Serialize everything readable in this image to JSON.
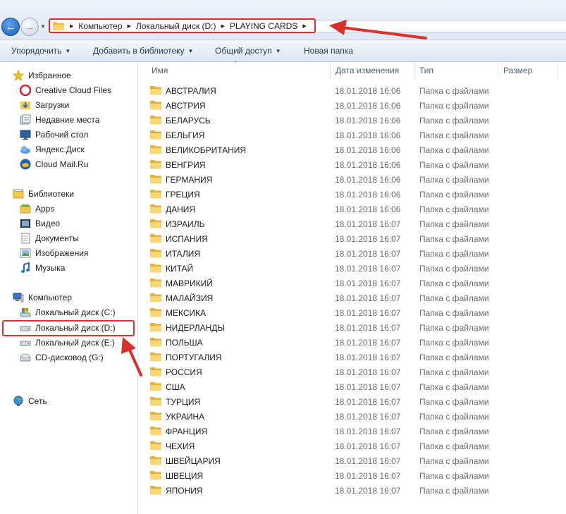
{
  "address_bar": {
    "breadcrumbs": [
      "Компьютер",
      "Локальный диск (D:)",
      "PLAYING CARDS"
    ]
  },
  "toolbar": {
    "organize": "Упорядочить",
    "add_to_library": "Добавить в библиотеку",
    "share": "Общий доступ",
    "new_folder": "Новая папка"
  },
  "sidebar": {
    "favorites": {
      "label": "Избранное",
      "items": [
        "Creative Cloud Files",
        "Загрузки",
        "Недавние места",
        "Рабочий стол",
        "Яндекс.Диск",
        "Cloud Mail.Ru"
      ]
    },
    "libraries": {
      "label": "Библиотеки",
      "items": [
        "Apps",
        "Видео",
        "Документы",
        "Изображения",
        "Музыка"
      ]
    },
    "computer": {
      "label": "Компьютер",
      "items": [
        "Локальный диск (C:)",
        "Локальный диск (D:)",
        "Локальный диск (E:)",
        "CD-дисковод (G:)"
      ]
    },
    "network": {
      "label": "Сеть"
    }
  },
  "columns": {
    "name": "Имя",
    "date": "Дата изменения",
    "type": "Тип",
    "size": "Размер"
  },
  "files": [
    {
      "name": "АВСТРАЛИЯ",
      "date": "18.01.2018 16:06",
      "type": "Папка с файлами"
    },
    {
      "name": "АВСТРИЯ",
      "date": "18.01.2018 16:06",
      "type": "Папка с файлами"
    },
    {
      "name": "БЕЛАРУСЬ",
      "date": "18.01.2018 16:06",
      "type": "Папка с файлами"
    },
    {
      "name": "БЕЛЬГИЯ",
      "date": "18.01.2018 16:06",
      "type": "Папка с файлами"
    },
    {
      "name": "ВЕЛИКОБРИТАНИЯ",
      "date": "18.01.2018 16:06",
      "type": "Папка с файлами"
    },
    {
      "name": "ВЕНГРИЯ",
      "date": "18.01.2018 16:06",
      "type": "Папка с файлами"
    },
    {
      "name": "ГЕРМАНИЯ",
      "date": "18.01.2018 16:06",
      "type": "Папка с файлами"
    },
    {
      "name": "ГРЕЦИЯ",
      "date": "18.01.2018 16:06",
      "type": "Папка с файлами"
    },
    {
      "name": "ДАНИЯ",
      "date": "18.01.2018 16:06",
      "type": "Папка с файлами"
    },
    {
      "name": "ИЗРАИЛЬ",
      "date": "18.01.2018 16:07",
      "type": "Папка с файлами"
    },
    {
      "name": "ИСПАНИЯ",
      "date": "18.01.2018 16:07",
      "type": "Папка с файлами"
    },
    {
      "name": "ИТАЛИЯ",
      "date": "18.01.2018 16:07",
      "type": "Папка с файлами"
    },
    {
      "name": "КИТАЙ",
      "date": "18.01.2018 16:07",
      "type": "Папка с файлами"
    },
    {
      "name": "МАВРИКИЙ",
      "date": "18.01.2018 16:07",
      "type": "Папка с файлами"
    },
    {
      "name": "МАЛАЙЗИЯ",
      "date": "18.01.2018 16:07",
      "type": "Папка с файлами"
    },
    {
      "name": "МЕКСИКА",
      "date": "18.01.2018 16:07",
      "type": "Папка с файлами"
    },
    {
      "name": "НИДЕРЛАНДЫ",
      "date": "18.01.2018 16:07",
      "type": "Папка с файлами"
    },
    {
      "name": "ПОЛЬША",
      "date": "18.01.2018 16:07",
      "type": "Папка с файлами"
    },
    {
      "name": "ПОРТУГАЛИЯ",
      "date": "18.01.2018 16:07",
      "type": "Папка с файлами"
    },
    {
      "name": "РОССИЯ",
      "date": "18.01.2018 16:07",
      "type": "Папка с файлами"
    },
    {
      "name": "США",
      "date": "18.01.2018 16:07",
      "type": "Папка с файлами"
    },
    {
      "name": "ТУРЦИЯ",
      "date": "18.01.2018 16:07",
      "type": "Папка с файлами"
    },
    {
      "name": "УКРАИНА",
      "date": "18.01.2018 16:07",
      "type": "Папка с файлами"
    },
    {
      "name": "ФРАНЦИЯ",
      "date": "18.01.2018 16:07",
      "type": "Папка с файлами"
    },
    {
      "name": "ЧЕХИЯ",
      "date": "18.01.2018 16:07",
      "type": "Папка с файлами"
    },
    {
      "name": "ШВЕЙЦАРИЯ",
      "date": "18.01.2018 16:07",
      "type": "Папка с файлами"
    },
    {
      "name": "ШВЕЦИЯ",
      "date": "18.01.2018 16:07",
      "type": "Папка с файлами"
    },
    {
      "name": "ЯПОНИЯ",
      "date": "18.01.2018 16:07",
      "type": "Папка с файлами"
    }
  ],
  "colors": {
    "annotation_red": "#d9302c",
    "folder_yellow": "#f2c94c",
    "toolbar_text": "#1e395b"
  }
}
